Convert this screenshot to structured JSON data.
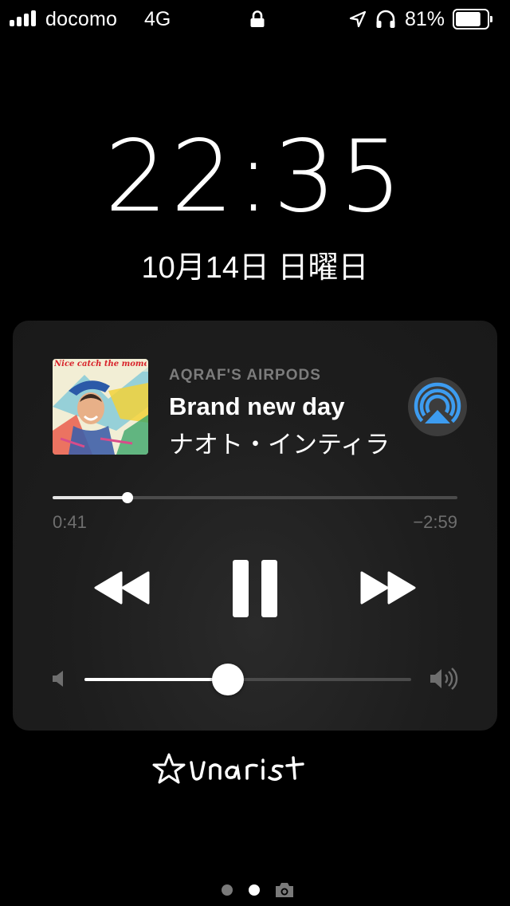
{
  "status_bar": {
    "carrier": "docomo",
    "network": "4G",
    "battery_percent_label": "81%",
    "battery_level": 0.81,
    "signal_bars": 4,
    "icons": [
      "signal-icon",
      "lock-icon",
      "location-icon",
      "headphones-icon",
      "battery-icon"
    ]
  },
  "lock_screen": {
    "time": "22:35",
    "date": "10月14日 日曜日"
  },
  "now_playing": {
    "device": "AQRAF'S AIRPODS",
    "title": "Brand new day",
    "artist": "ナオト・インティライミ",
    "album_art_caption": "Nice catch the moment!",
    "elapsed": "0:41",
    "remaining": "−2:59",
    "progress": 0.185,
    "volume": 0.44,
    "controls": {
      "rewind_icon": "rewind-icon",
      "pause_icon": "pause-icon",
      "forward_icon": "fast-forward-icon",
      "airplay_icon": "airplay-icon"
    },
    "accent_color": "#3d9cf0"
  },
  "signature_text": "Unarist",
  "pager": {
    "pages": 2,
    "current": 2,
    "camera_icon": "camera-icon"
  }
}
